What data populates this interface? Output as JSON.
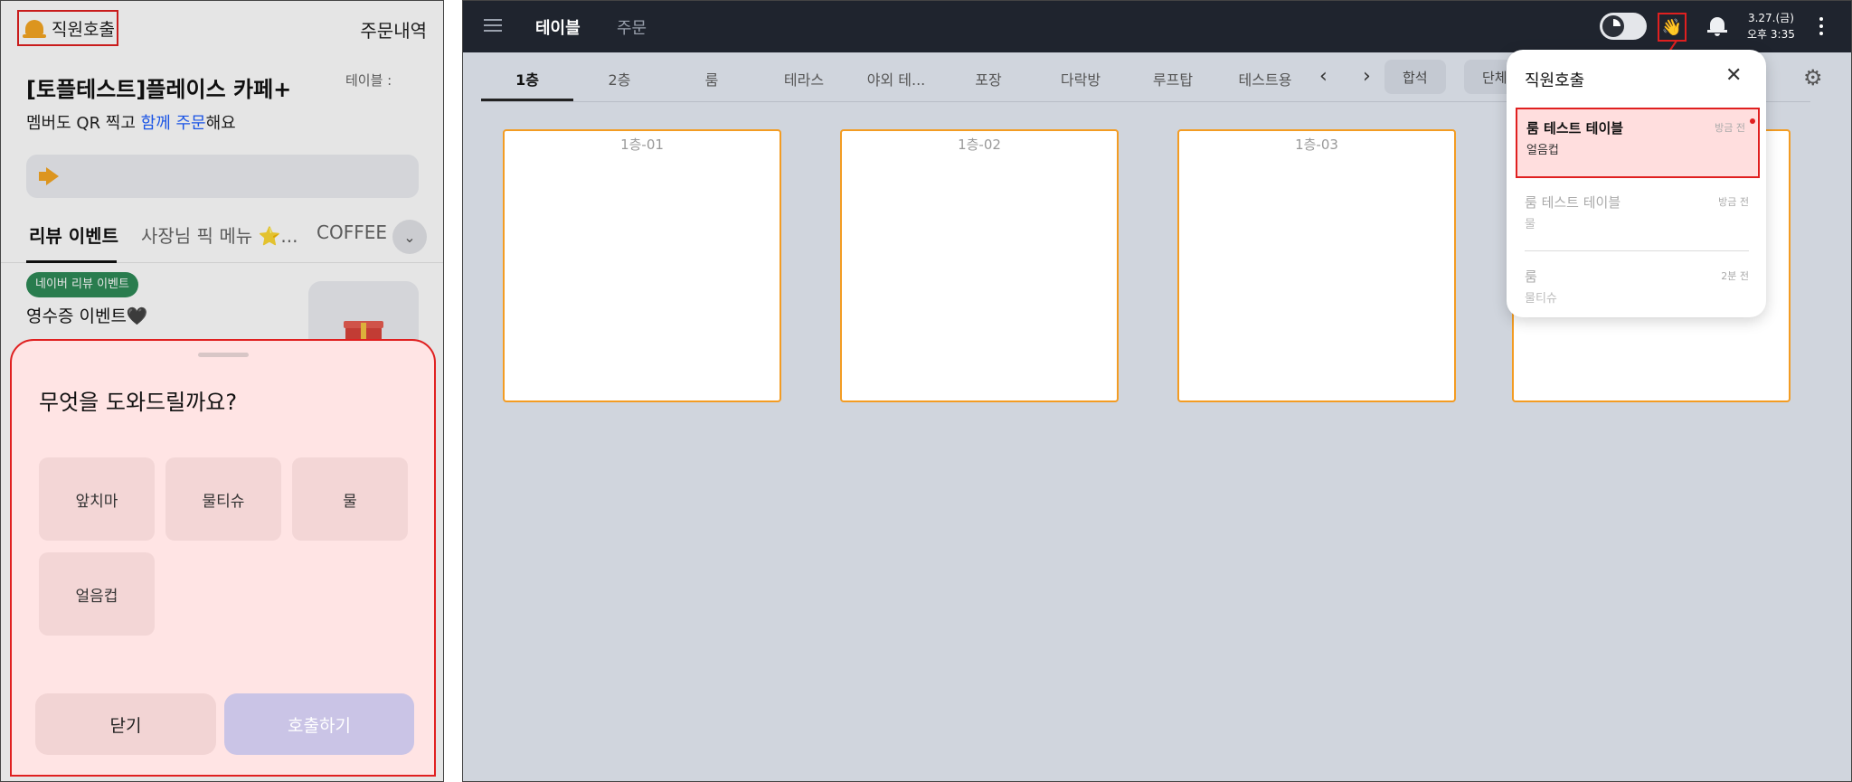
{
  "mobile": {
    "staff_call": "직원호출",
    "order_history": "주문내역",
    "store_name": "[토플테스트]플레이스 카페+",
    "table_label": "테이블 :",
    "tagline_pre": "멤버도 QR 찍고 ",
    "tagline_highlight": "함께 주문",
    "tagline_post": "해요",
    "category_tabs": [
      "리뷰 이벤트",
      "사장님 픽 메뉴 ⭐...",
      "COFFEE"
    ],
    "event": {
      "badge": "네이버 리뷰 이벤트",
      "title": "영수증 이벤트🖤"
    },
    "sheet": {
      "title": "무엇을 도와드릴까요?",
      "options": [
        "앞치마",
        "물티슈",
        "물",
        "얼음컵"
      ],
      "close": "닫기",
      "call": "호출하기"
    }
  },
  "pos": {
    "top_tabs": [
      "테이블",
      "주문"
    ],
    "clock": {
      "date": "3.27.(금)",
      "time": "오후 3:35"
    },
    "floor_tabs": [
      "1층",
      "2층",
      "룸",
      "테라스",
      "야외 테...",
      "포장",
      "다락방",
      "루프탑",
      "테스트용"
    ],
    "buttons": {
      "merge": "합석",
      "group": "단체"
    },
    "tables": [
      "1층-01",
      "1층-02",
      "1층-03"
    ],
    "popup": {
      "title": "직원호출",
      "calls": [
        {
          "table": "룸 테스트 테이블",
          "time": "방금 전",
          "item": "얼음컵"
        },
        {
          "table": "룸 테스트 테이블",
          "time": "방금 전",
          "item": "물"
        },
        {
          "table": "룸",
          "time": "2분 전",
          "item": "물티슈"
        }
      ]
    }
  },
  "colors": {
    "highlight_red": "#e02020",
    "table_border": "#f39c23",
    "topbar": "#1f242e",
    "accent_blue": "#1e5eff"
  },
  "icons": [
    "bell-icon",
    "megaphone-icon",
    "chevron-down-icon",
    "gift-icon",
    "menu-icon",
    "theme-toggle-icon",
    "hand-wave-icon",
    "notification-bell-icon",
    "more-vertical-icon",
    "chevron-left-icon",
    "chevron-right-icon",
    "gear-icon",
    "close-icon"
  ]
}
